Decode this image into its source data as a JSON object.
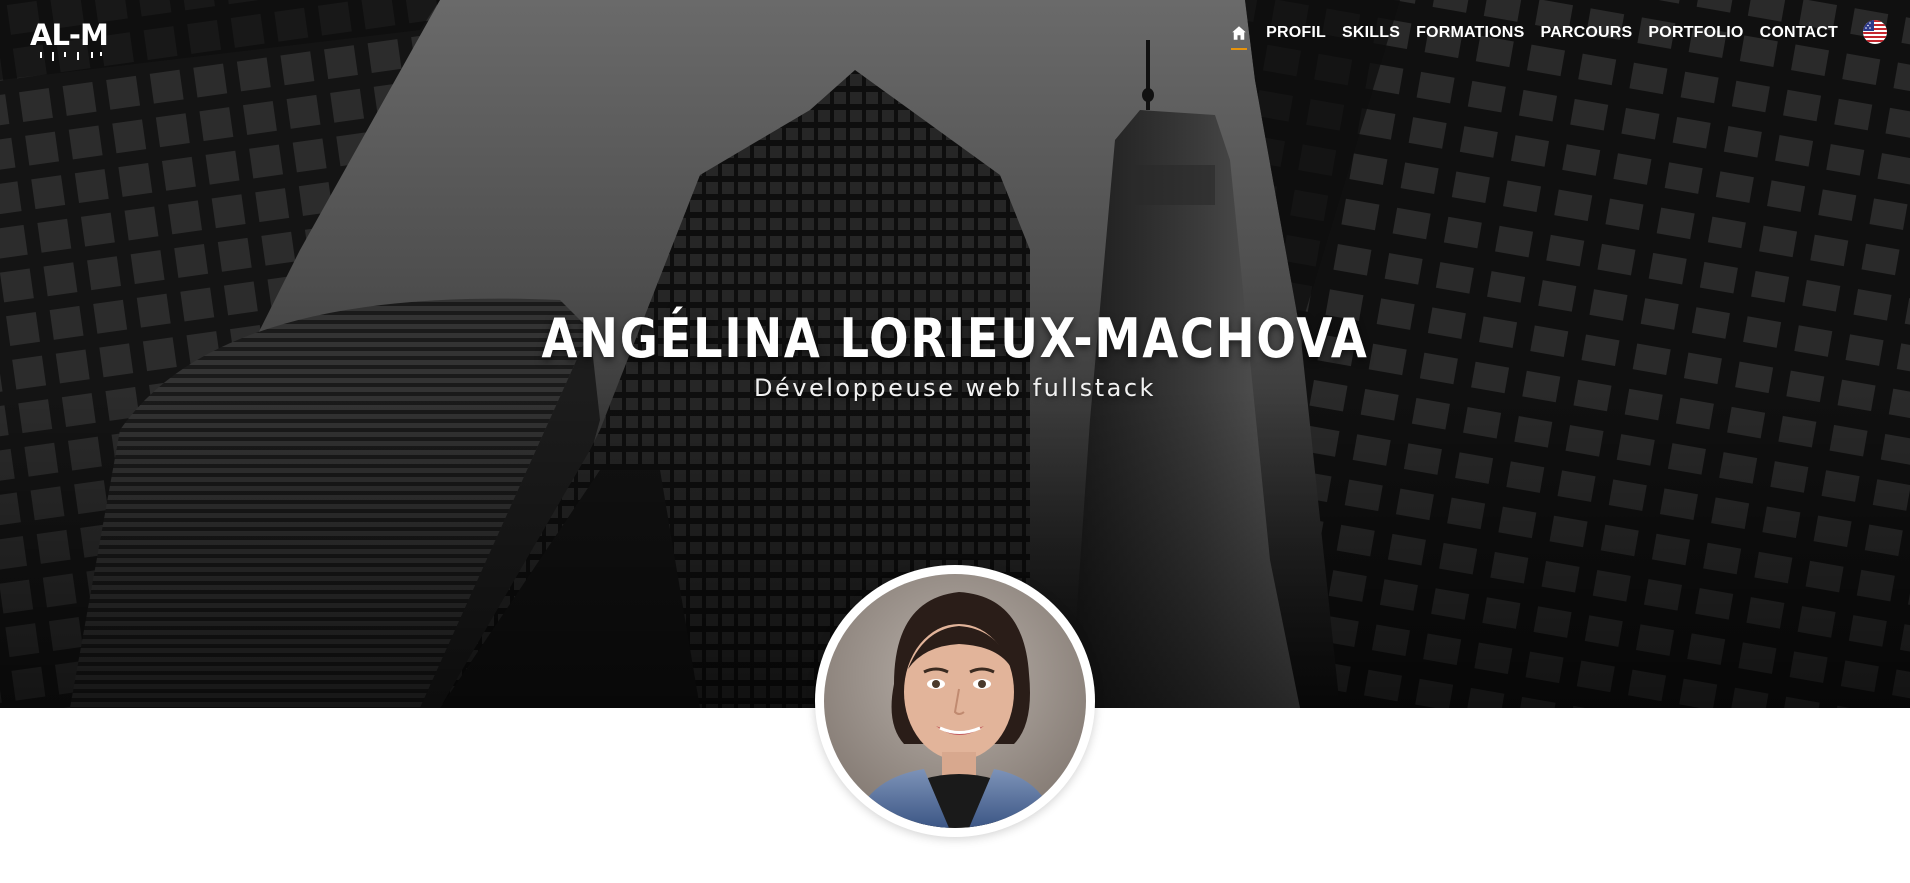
{
  "brand": {
    "logo_text": "AL-M"
  },
  "nav": {
    "home_icon": "home-icon",
    "items": [
      {
        "label": "PROFIL"
      },
      {
        "label": "SKILLS"
      },
      {
        "label": "FORMATIONS"
      },
      {
        "label": "PARCOURS"
      },
      {
        "label": "PORTFOLIO"
      },
      {
        "label": "CONTACT"
      }
    ],
    "language_icon": "us-flag-icon",
    "active_indicator_color": "#e8940c"
  },
  "hero": {
    "name": "ANGÉLINA LORIEUX-MACHOVA",
    "subtitle": "Développeuse web fullstack",
    "background": "black-and-white-skyscrapers-photo"
  },
  "profile": {
    "avatar": "profile-photo"
  }
}
